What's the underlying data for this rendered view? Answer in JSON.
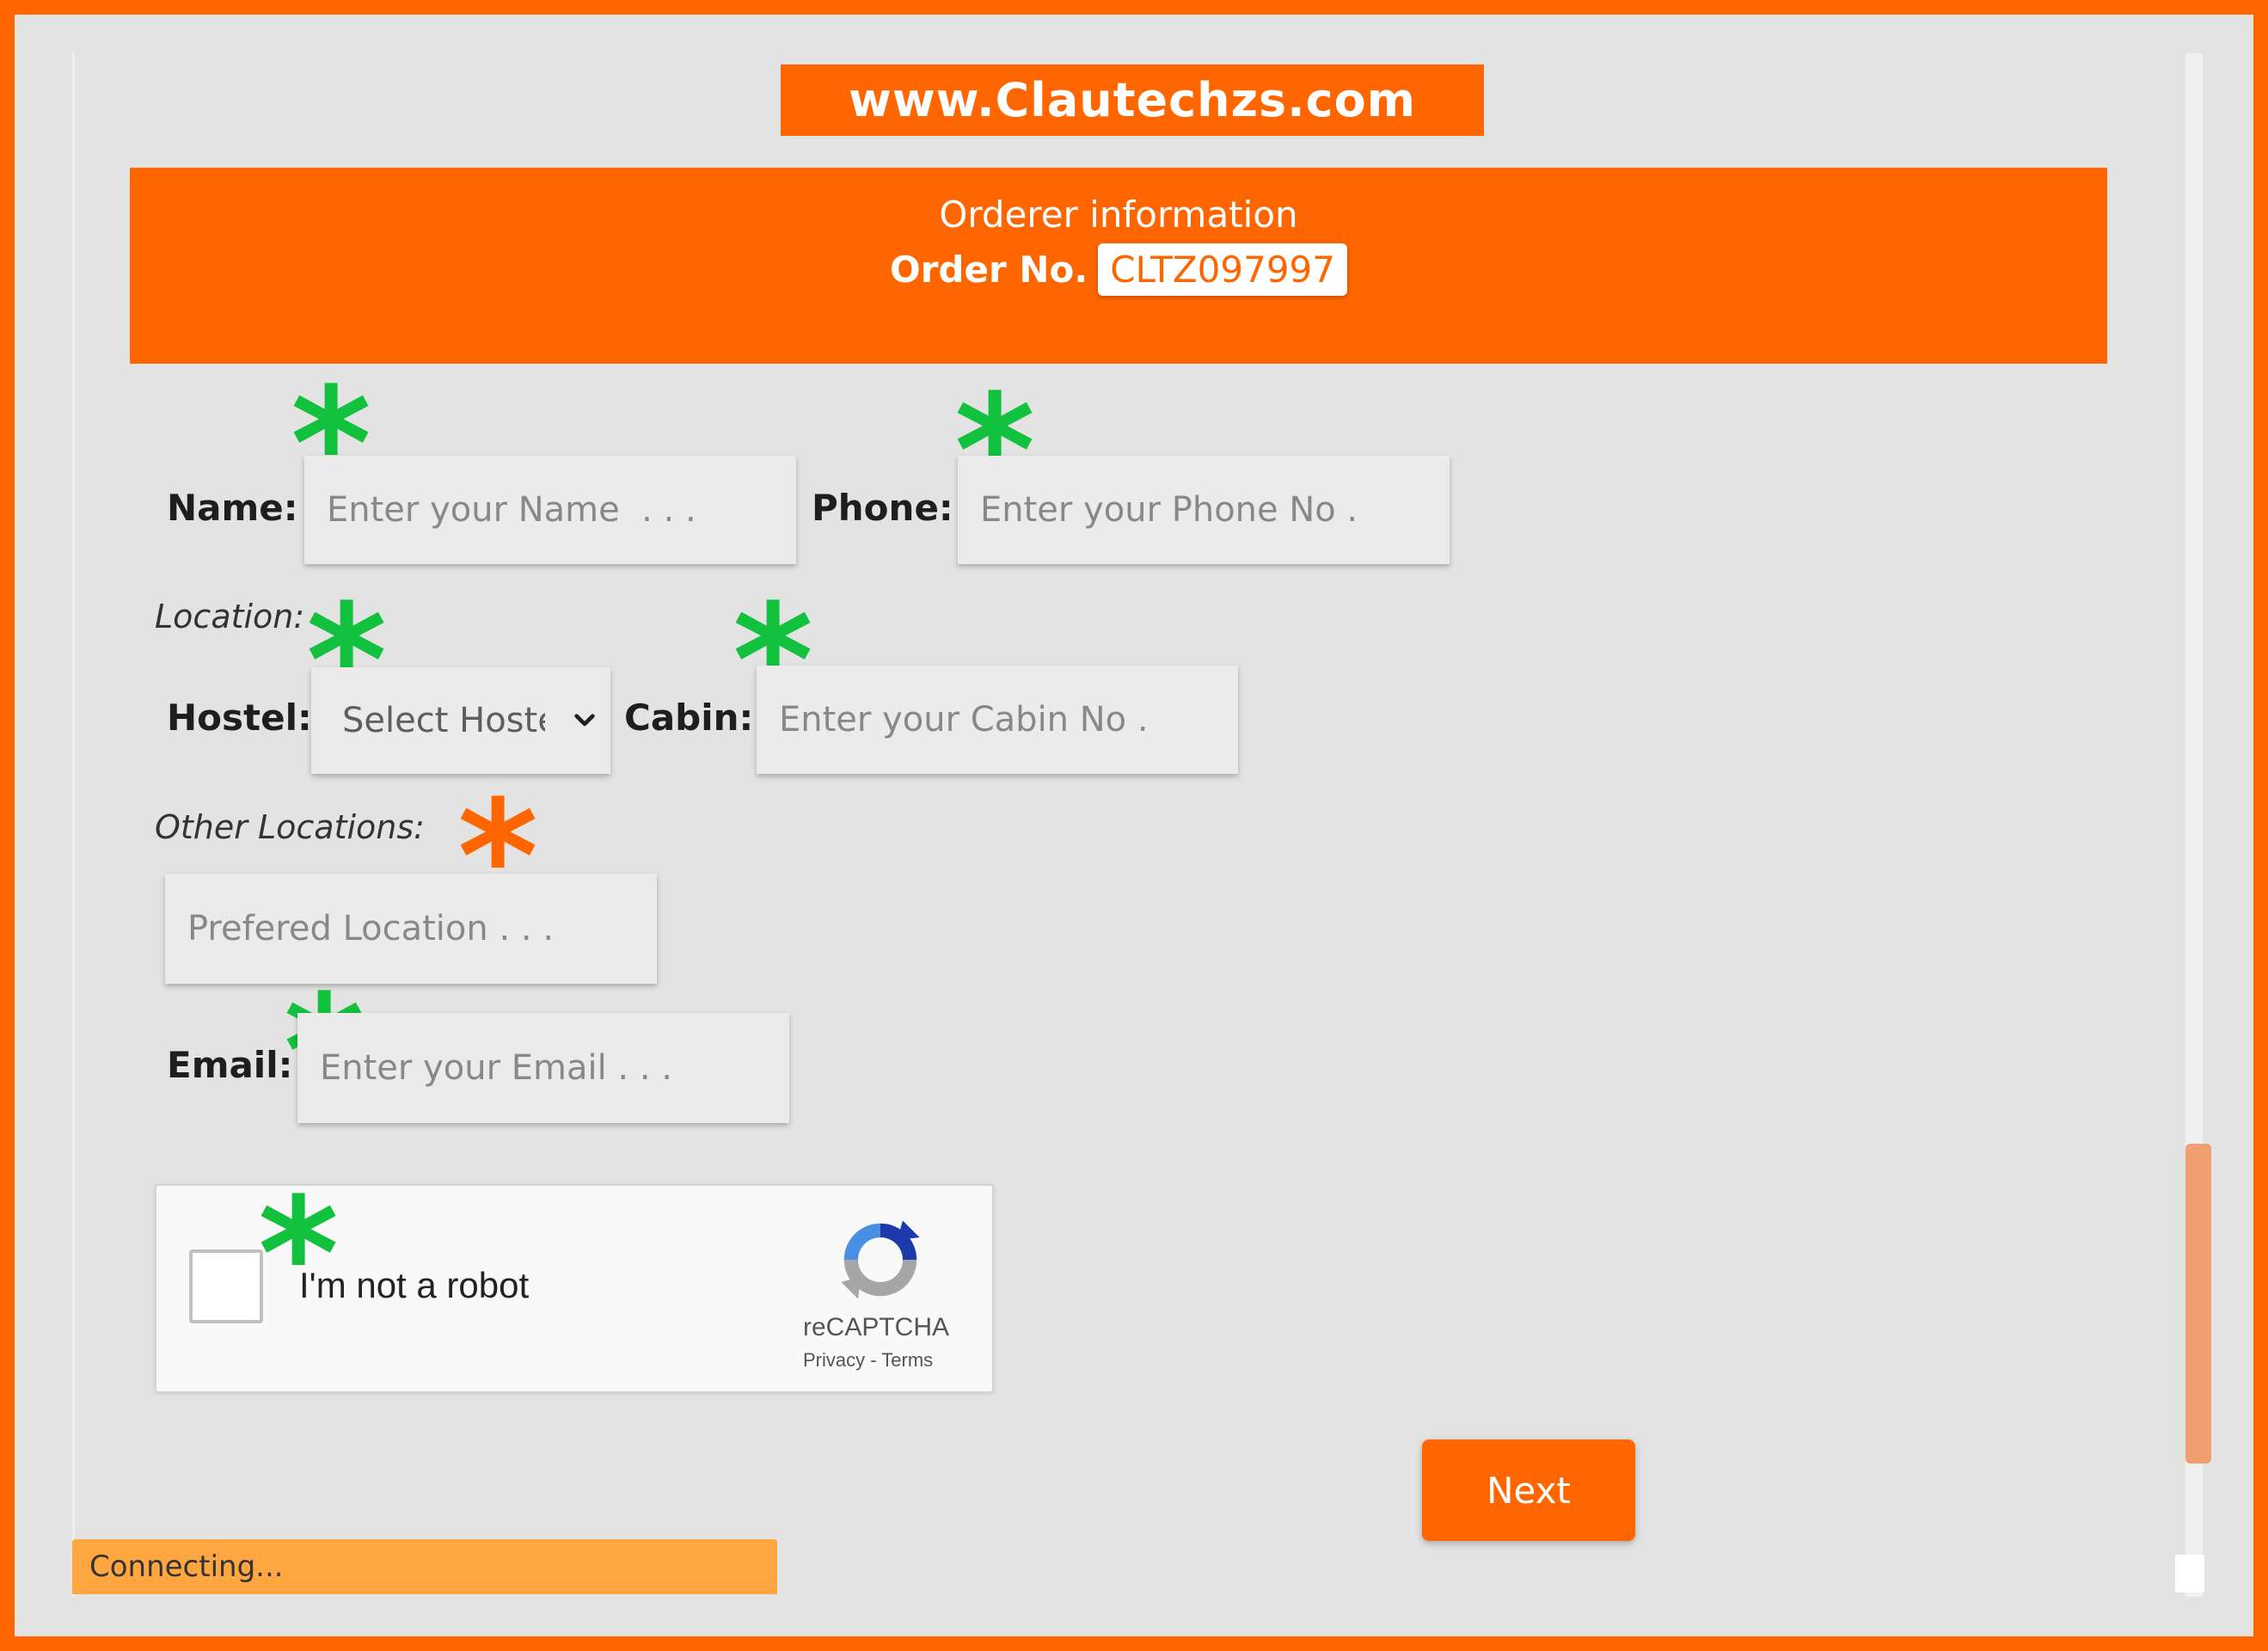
{
  "site_banner": "www.Clautechzs.com",
  "header": {
    "title": "Orderer information",
    "order_label": "Order No.",
    "order_number": "CLTZ097997"
  },
  "form": {
    "name_label": "Name:",
    "name_placeholder": "Enter your Name  . . .",
    "phone_label": "Phone:",
    "phone_placeholder": "Enter your Phone No .",
    "location_label": "Location:",
    "hostel_label": "Hostel:",
    "hostel_value": "Select Hostel",
    "cabin_label": "Cabin:",
    "cabin_placeholder": "Enter your Cabin No .",
    "other_locations_label": "Other Locations:",
    "preferred_location_placeholder": "Prefered Location . . .",
    "email_label": "Email:",
    "email_placeholder": "Enter your Email . . ."
  },
  "required_marker": "*",
  "captcha": {
    "text": "I'm not a robot",
    "brand": "reCAPTCHA",
    "links": "Privacy - Terms"
  },
  "next_button": "Next",
  "status": "Connecting...",
  "colors": {
    "accent": "#ff6600",
    "required_green": "#12c13d",
    "status_bar": "#ffa640"
  }
}
